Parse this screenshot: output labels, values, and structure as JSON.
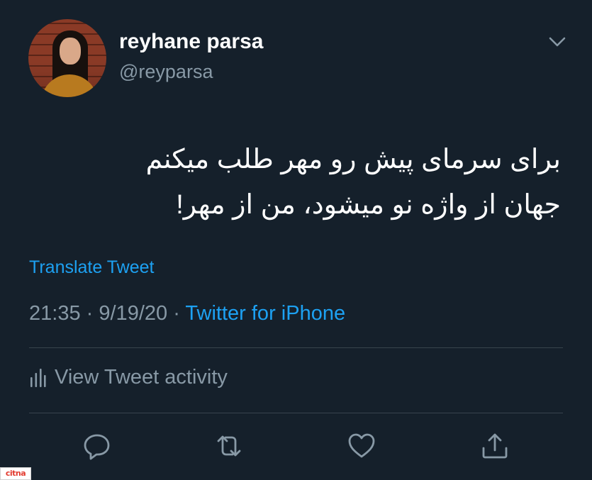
{
  "tweet": {
    "author": {
      "name": "reyhane parsa",
      "handle": "@reyparsa"
    },
    "text_lines": [
      "برای سرمای پیش رو مهر طلب میکنم",
      "جهان از واژه نو میشود، من از مهر!"
    ],
    "translate_label": "Translate Tweet",
    "time": "21:35",
    "date": "9/19/20",
    "separator": "·",
    "source": "Twitter for iPhone",
    "activity_label": "View Tweet activity"
  },
  "icons": {
    "menu": "chevron-down-icon",
    "activity": "bar-chart-icon",
    "actions": [
      "reply-icon",
      "retweet-icon",
      "like-icon",
      "share-icon"
    ]
  },
  "watermark": "citna",
  "colors": {
    "background": "#15202b",
    "text": "#ffffff",
    "secondary": "#8899a6",
    "accent": "#1da1f2",
    "divider": "#38444d"
  }
}
